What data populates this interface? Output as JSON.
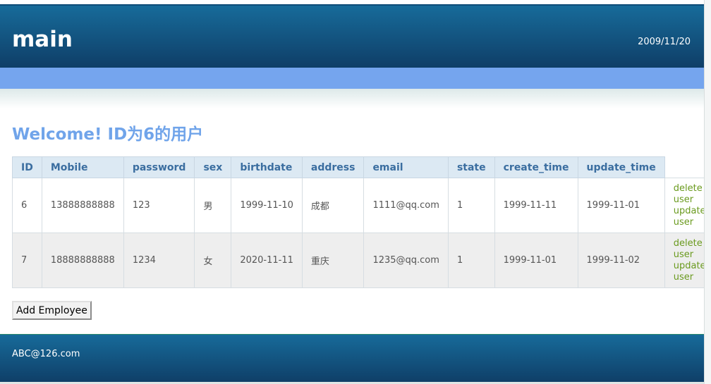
{
  "header": {
    "title": "main",
    "date": "2009/11/20"
  },
  "welcome": "Welcome! ID为6的用户",
  "table": {
    "columns": [
      "ID",
      "Mobile",
      "password",
      "sex",
      "birthdate",
      "address",
      "email",
      "state",
      "create_time",
      "update_time"
    ],
    "rows": [
      {
        "id": "6",
        "mobile": "13888888888",
        "password": "123",
        "sex": "男",
        "birthdate": "1999-11-10",
        "address": "成都",
        "email": "1111@qq.com",
        "state": "1",
        "create_time": "1999-11-11",
        "update_time": "1999-11-01",
        "delete_label": "delete user",
        "update_label": "update user"
      },
      {
        "id": "7",
        "mobile": "18888888888",
        "password": "1234",
        "sex": "女",
        "birthdate": "2020-11-11",
        "address": "重庆",
        "email": "1235@qq.com",
        "state": "1",
        "create_time": "1999-11-01",
        "update_time": "1999-11-02",
        "delete_label": "delete user",
        "update_label": "update user"
      }
    ]
  },
  "add_button": "Add Employee",
  "footer": {
    "email": "ABC@126.com"
  },
  "colors": {
    "header": "#0f3e67",
    "navbar": "#75a5ee",
    "welcome": "#70a4ea",
    "link": "#6a9a1e"
  }
}
